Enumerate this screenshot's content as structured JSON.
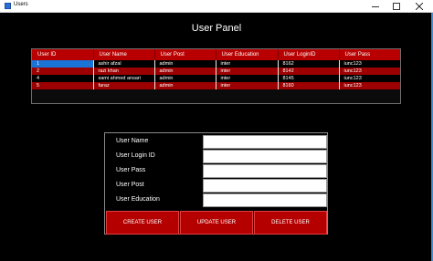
{
  "window": {
    "title": "Users",
    "accent": "#3a8fd8"
  },
  "panel": {
    "title": "User Panel"
  },
  "table": {
    "columns": [
      "User ID",
      "User Name",
      "User Post",
      "User Education",
      "User LoginID",
      "User Pass"
    ],
    "rows": [
      [
        "1",
        "ashir afzal",
        "admin",
        "inter",
        "8162",
        "iunc123"
      ],
      [
        "2",
        "razi khan",
        "admin",
        "inter",
        "8142",
        "iunc123"
      ],
      [
        "4",
        "sami ahmed ansari",
        "admin",
        "inter",
        "8145",
        "iunc123"
      ],
      [
        "5",
        "faraz",
        "admin",
        "inter",
        "8160",
        "iunc123"
      ]
    ],
    "selected_cell": "1",
    "row_colors": {
      "odd": "#000000",
      "even": "#9c0000",
      "header": "#b80000",
      "selected": "#1a73d6"
    }
  },
  "form": {
    "labels": {
      "name": "User Name",
      "login_id": "User Login ID",
      "pass": "User Pass",
      "post": "User Post",
      "education": "User Education"
    },
    "values": {
      "name": "",
      "login_id": "",
      "pass": "",
      "post": "",
      "education": ""
    },
    "buttons": {
      "create": "CREATE USER",
      "update": "UPDATE USER",
      "delete": "DELETE USER"
    }
  }
}
